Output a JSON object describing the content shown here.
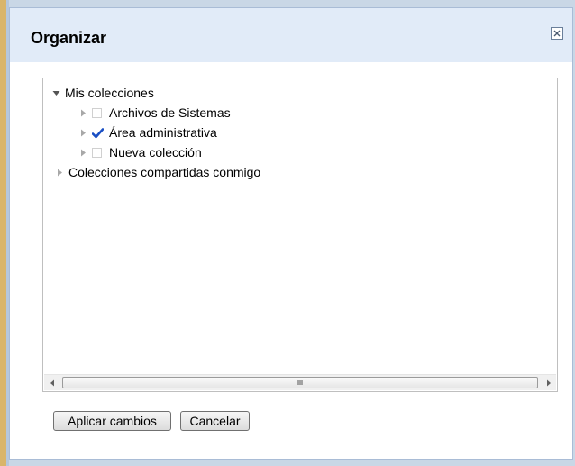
{
  "dialog": {
    "title": "Organizar",
    "close_icon": "close-icon"
  },
  "tree": {
    "root": {
      "label": "Mis colecciones",
      "expanded": true,
      "children": [
        {
          "label": "Archivos de Sistemas",
          "checked": false,
          "expanded": false
        },
        {
          "label": "Área administrativa",
          "checked": true,
          "expanded": false
        },
        {
          "label": "Nueva colección",
          "checked": false,
          "expanded": false
        }
      ]
    },
    "shared": {
      "label": "Colecciones compartidas conmigo",
      "expanded": false
    }
  },
  "buttons": {
    "apply_label": "Aplicar cambios",
    "cancel_label": "Cancelar"
  },
  "colors": {
    "titlebar_bg": "#e1ebf8",
    "checkmark": "#1a4fc4",
    "border": "#a9bcd6"
  }
}
